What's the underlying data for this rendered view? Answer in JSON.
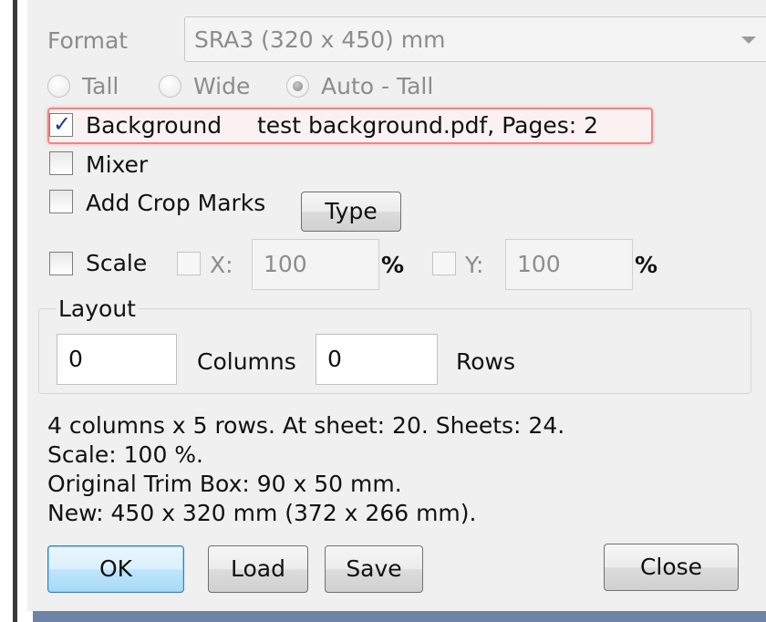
{
  "format": {
    "label": "Format",
    "value": "SRA3 (320 x 450) mm"
  },
  "orientation": {
    "options": [
      "Tall",
      "Wide",
      "Auto - Tall"
    ],
    "selected": "Auto - Tall"
  },
  "background": {
    "label": "Background",
    "checked": true,
    "info": "test background.pdf, Pages: 2"
  },
  "mixer": {
    "label": "Mixer",
    "checked": false
  },
  "crop_marks": {
    "label": "Add Crop Marks",
    "checked": false,
    "type_button": "Type"
  },
  "scale": {
    "label": "Scale",
    "checked": false,
    "x_label": "X:",
    "x_value": "100",
    "x_unit": "%",
    "y_label": "Y:",
    "y_value": "100",
    "y_unit": "%"
  },
  "layout": {
    "title": "Layout",
    "columns_value": "0",
    "columns_label": "Columns",
    "rows_value": "0",
    "rows_label": "Rows"
  },
  "summary": [
    "4 columns x 5 rows. At sheet: 20. Sheets: 24.",
    "Scale: 100 %.",
    "Original Trim Box: 90 x 50 mm.",
    "New: 450 x 320 mm (372 x 266 mm)."
  ],
  "buttons": {
    "ok": "OK",
    "load": "Load",
    "save": "Save",
    "close": "Close"
  }
}
